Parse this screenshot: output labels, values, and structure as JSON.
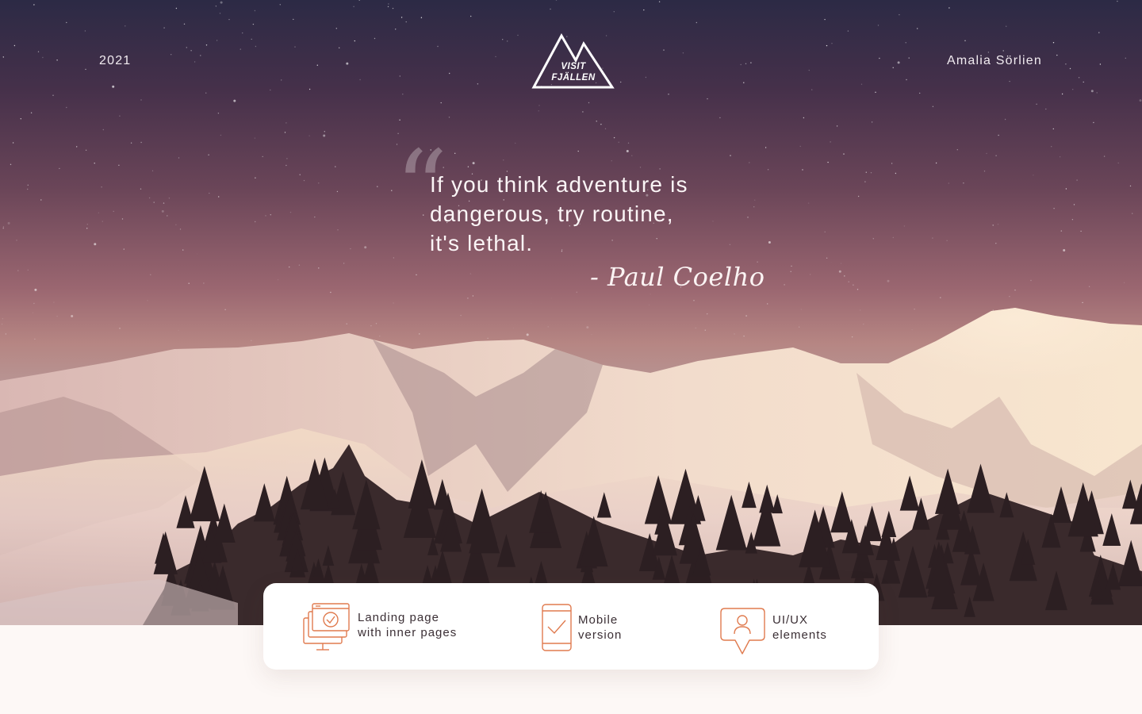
{
  "header": {
    "year": "2021",
    "author": "Amalia Sörlien",
    "logo": {
      "line1": "VISIT",
      "line2": "FJÄLLEN",
      "icon": "mountain-logo-icon"
    }
  },
  "quote": {
    "mark": "“",
    "lines": [
      "If you think adventure is",
      "dangerous, try routine,",
      "it's lethal."
    ],
    "author": "- Paul Coelho"
  },
  "features": [
    {
      "icon": "landing-pages-icon",
      "line1": "Landing page",
      "line2": "with inner pages"
    },
    {
      "icon": "mobile-icon",
      "line1": "Mobile",
      "line2": "version"
    },
    {
      "icon": "user-speech-bubble-icon",
      "line1": "UI/UX",
      "line2": "elements"
    }
  ],
  "colors": {
    "accent": "#e07b4f",
    "background": "#fdf8f6",
    "text_dark": "#3b2f35",
    "text_light": "#ffffff"
  }
}
